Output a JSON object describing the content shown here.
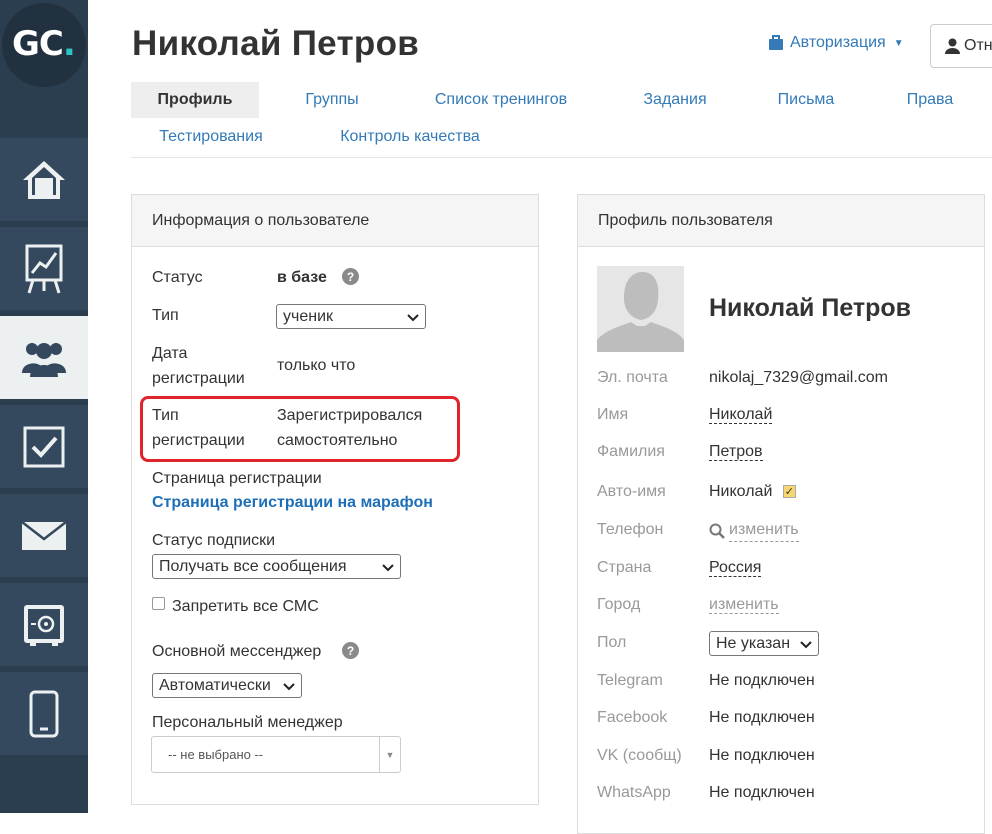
{
  "logo": {
    "text": "GC",
    "dot": "."
  },
  "header": {
    "title": "Николай Петров",
    "auth_label": "Авторизация",
    "top_button_label": "Отн"
  },
  "tabs": [
    {
      "label": "Профиль",
      "active": true
    },
    {
      "label": "Группы"
    },
    {
      "label": "Список тренингов"
    },
    {
      "label": "Задания"
    },
    {
      "label": "Письма"
    },
    {
      "label": "Права"
    },
    {
      "label": "Тестирования"
    },
    {
      "label": "Контроль качества"
    }
  ],
  "info_panel": {
    "title": "Информация о пользователе",
    "status_label": "Статус",
    "status_value": "в базе",
    "type_label": "Тип",
    "type_value": "ученик",
    "reg_date_label_1": "Дата",
    "reg_date_label_2": "регистрации",
    "reg_date_value": "только что",
    "reg_type_label_1": "Тип",
    "reg_type_label_2": "регистрации",
    "reg_type_value_1": "Зарегистрировался",
    "reg_type_value_2": "самостоятельно",
    "reg_page_label": "Страница регистрации",
    "reg_page_link": "Страница регистрации на марафон",
    "subscription_label": "Статус подписки",
    "subscription_value": "Получать все сообщения",
    "ban_sms_label": "Запретить все СМС",
    "messenger_label": "Основной мессенджер",
    "messenger_value": "Автоматически",
    "manager_label": "Персональный менеджер",
    "manager_value": "-- не выбрано --"
  },
  "profile_panel": {
    "title": "Профиль пользователя",
    "name": "Николай Петров",
    "rows": [
      {
        "label": "Эл. почта",
        "value": "nikolaj_7329@gmail.com"
      },
      {
        "label": "Имя",
        "value": "Николай"
      },
      {
        "label": "Фамилия",
        "value": "Петров"
      },
      {
        "label": "Авто-имя",
        "value": "Николай"
      },
      {
        "label": "Телефон",
        "value": "изменить"
      },
      {
        "label": "Страна",
        "value": "Россия"
      },
      {
        "label": "Город",
        "value": "изменить"
      },
      {
        "label": "Пол",
        "value": "Не указан"
      },
      {
        "label": "Telegram",
        "value": "Не подключен"
      },
      {
        "label": "Facebook",
        "value": "Не подключен"
      },
      {
        "label": "VK (сообщ)",
        "value": "Не подключен"
      },
      {
        "label": "WhatsApp",
        "value": "Не подключен"
      }
    ]
  },
  "sidebar": {
    "items": [
      {
        "icon": "home-icon"
      },
      {
        "icon": "chart-board-icon"
      },
      {
        "icon": "users-icon",
        "active": true
      },
      {
        "icon": "checkbox-icon"
      },
      {
        "icon": "mail-icon"
      },
      {
        "icon": "safe-icon"
      },
      {
        "icon": "mobile-icon"
      }
    ]
  },
  "colors": {
    "sidebar": "#34495e",
    "accent": "#337ab7",
    "highlight": "#e0242b"
  }
}
